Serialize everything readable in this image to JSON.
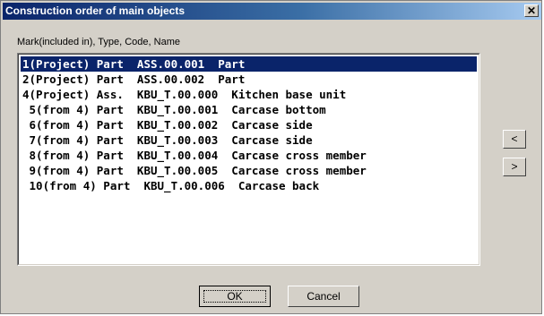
{
  "window": {
    "title": "Construction order of main objects",
    "close_label": "✕"
  },
  "list": {
    "header": "Mark(included in), Type, Code, Name",
    "items": [
      {
        "text": "1(Project) Part  ASS.00.001  Part",
        "selected": true
      },
      {
        "text": "2(Project) Part  ASS.00.002  Part",
        "selected": false
      },
      {
        "text": "4(Project) Ass.  KBU_T.00.000  Kitchen base unit",
        "selected": false
      },
      {
        "text": " 5(from 4) Part  KBU_T.00.001  Carcase bottom",
        "selected": false
      },
      {
        "text": " 6(from 4) Part  KBU_T.00.002  Carcase side",
        "selected": false
      },
      {
        "text": " 7(from 4) Part  KBU_T.00.003  Carcase side",
        "selected": false
      },
      {
        "text": " 8(from 4) Part  KBU_T.00.004  Carcase cross member",
        "selected": false
      },
      {
        "text": " 9(from 4) Part  KBU_T.00.005  Carcase cross member",
        "selected": false
      },
      {
        "text": " 10(from 4) Part  KBU_T.00.006  Carcase back",
        "selected": false
      }
    ]
  },
  "side_buttons": {
    "up_label": "<",
    "down_label": ">"
  },
  "footer": {
    "ok_label": "OK",
    "cancel_label": "Cancel"
  }
}
